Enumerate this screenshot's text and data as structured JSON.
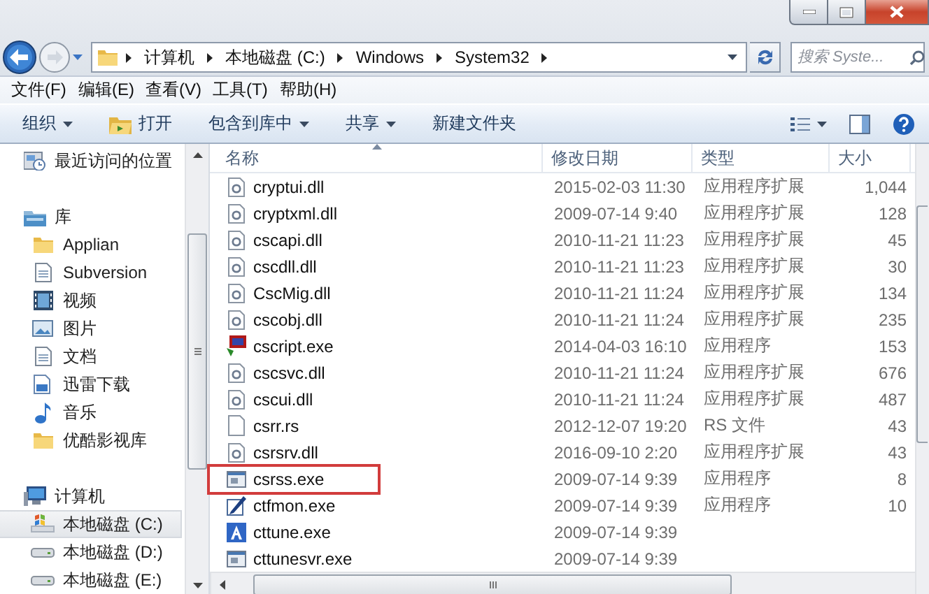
{
  "address": {
    "crumbs": [
      "计算机",
      "本地磁盘 (C:)",
      "Windows",
      "System32"
    ]
  },
  "search": {
    "placeholder": "搜索 Syste..."
  },
  "menu": [
    "文件(F)",
    "编辑(E)",
    "查看(V)",
    "工具(T)",
    "帮助(H)"
  ],
  "toolbar": [
    {
      "label": "组织",
      "kind": "dropdown"
    },
    {
      "label": "打开",
      "kind": "open"
    },
    {
      "label": "包含到库中",
      "kind": "dropdown"
    },
    {
      "label": "共享",
      "kind": "dropdown"
    },
    {
      "label": "新建文件夹",
      "kind": "plain"
    }
  ],
  "sidebar": {
    "items": [
      {
        "label": "最近访问的位置",
        "kind": "recent",
        "selected": false
      },
      {
        "label": "库",
        "kind": "library",
        "selected": false,
        "children": [
          {
            "label": "Applian",
            "kind": "folder",
            "selected": false
          },
          {
            "label": "Subversion",
            "kind": "document",
            "selected": false
          },
          {
            "label": "视频",
            "kind": "video",
            "selected": false
          },
          {
            "label": "图片",
            "kind": "picture",
            "selected": false
          },
          {
            "label": "文档",
            "kind": "document",
            "selected": false
          },
          {
            "label": "迅雷下载",
            "kind": "download",
            "selected": false
          },
          {
            "label": "音乐",
            "kind": "music",
            "selected": false
          },
          {
            "label": "优酷影视库",
            "kind": "folder",
            "selected": false
          }
        ]
      },
      {
        "label": "计算机",
        "kind": "computer",
        "selected": false,
        "children": [
          {
            "label": "本地磁盘 (C:)",
            "kind": "system-drive",
            "selected": true
          },
          {
            "label": "本地磁盘 (D:)",
            "kind": "drive",
            "selected": false
          },
          {
            "label": "本地磁盘 (E:)",
            "kind": "drive",
            "selected": false
          }
        ]
      }
    ]
  },
  "files": {
    "columns": [
      {
        "label": "名称",
        "sorted": true
      },
      {
        "label": "修改日期",
        "sorted": false
      },
      {
        "label": "类型",
        "sorted": false
      },
      {
        "label": "大小",
        "sorted": false
      }
    ],
    "rows": [
      {
        "name": "cryptui.dll",
        "modified": "2015-02-03 11:30",
        "type": "应用程序扩展",
        "size": "1,044",
        "kind": "library",
        "highlighted": false
      },
      {
        "name": "cryptxml.dll",
        "modified": "2009-07-14 9:40",
        "type": "应用程序扩展",
        "size": "128",
        "kind": "library",
        "highlighted": false
      },
      {
        "name": "cscapi.dll",
        "modified": "2010-11-21 11:23",
        "type": "应用程序扩展",
        "size": "45",
        "kind": "library",
        "highlighted": false
      },
      {
        "name": "cscdll.dll",
        "modified": "2010-11-21 11:23",
        "type": "应用程序扩展",
        "size": "30",
        "kind": "library",
        "highlighted": false
      },
      {
        "name": "CscMig.dll",
        "modified": "2010-11-21 11:24",
        "type": "应用程序扩展",
        "size": "134",
        "kind": "library",
        "highlighted": false
      },
      {
        "name": "cscobj.dll",
        "modified": "2010-11-21 11:24",
        "type": "应用程序扩展",
        "size": "235",
        "kind": "library",
        "highlighted": false
      },
      {
        "name": "cscript.exe",
        "modified": "2014-04-03 16:10",
        "type": "应用程序",
        "size": "153",
        "kind": "script",
        "highlighted": false
      },
      {
        "name": "cscsvc.dll",
        "modified": "2010-11-21 11:24",
        "type": "应用程序扩展",
        "size": "676",
        "kind": "library",
        "highlighted": false
      },
      {
        "name": "cscui.dll",
        "modified": "2010-11-21 11:24",
        "type": "应用程序扩展",
        "size": "487",
        "kind": "library",
        "highlighted": false
      },
      {
        "name": "csrr.rs",
        "modified": "2012-12-07 19:20",
        "type": "RS 文件",
        "size": "43",
        "kind": "blank",
        "highlighted": false
      },
      {
        "name": "csrsrv.dll",
        "modified": "2016-09-10 2:20",
        "type": "应用程序扩展",
        "size": "43",
        "kind": "library",
        "highlighted": false
      },
      {
        "name": "csrss.exe",
        "modified": "2009-07-14 9:39",
        "type": "应用程序",
        "size": "8",
        "kind": "window",
        "highlighted": true
      },
      {
        "name": "ctfmon.exe",
        "modified": "2009-07-14 9:39",
        "type": "应用程序",
        "size": "10",
        "kind": "pen",
        "highlighted": false
      },
      {
        "name": "cttune.exe",
        "modified": "2009-07-14 9:39",
        "kind": "font",
        "highlighted": false
      },
      {
        "name": "cttunesvr.exe",
        "modified": "2009-07-14 9:39",
        "kind": "window",
        "highlighted": false
      }
    ]
  }
}
